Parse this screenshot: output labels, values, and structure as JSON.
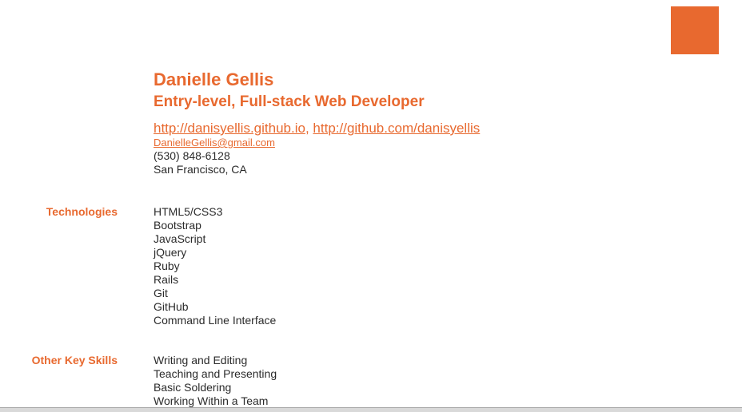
{
  "header": {
    "name": "Danielle Gellis",
    "subtitle": "Entry-level, Full-stack Web Developer",
    "link_portfolio": "http://danisyellis.github.io",
    "link_separator": ",",
    "link_github": "http://github.com/danisyellis",
    "email": "DanielleGellis@gmail.com",
    "phone": "(530) 848-6128",
    "location": "San Francisco, CA"
  },
  "technologies": {
    "label": "Technologies",
    "items": [
      "HTML5/CSS3",
      "Bootstrap",
      "JavaScript",
      "jQuery",
      "Ruby",
      "Rails",
      "Git",
      "GitHub",
      "Command Line Interface"
    ]
  },
  "skills": {
    "label": "Other Key Skills",
    "items": [
      "Writing and Editing",
      "Teaching and Presenting",
      "Basic Soldering",
      "Working Within a Team"
    ]
  },
  "colors": {
    "accent": "#e8692f",
    "text": "#2b2b2b"
  }
}
